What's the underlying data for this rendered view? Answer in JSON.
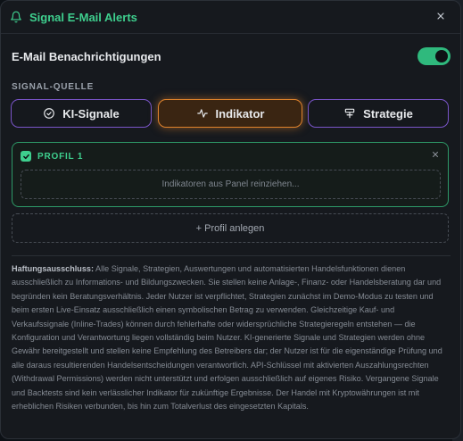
{
  "header": {
    "title": "Signal E-Mail Alerts"
  },
  "email": {
    "label": "E-Mail Benachrichtigungen",
    "enabled": true
  },
  "signal_source": {
    "label": "SIGNAL-QUELLE",
    "options": [
      {
        "label": "KI-Signale",
        "icon": "check-circle-icon",
        "selected": false
      },
      {
        "label": "Indikator",
        "icon": "activity-icon",
        "selected": true
      },
      {
        "label": "Strategie",
        "icon": "strategy-icon",
        "selected": false
      }
    ]
  },
  "profiles": [
    {
      "name": "PROFIL 1",
      "dropzone_text": "Indikatoren aus Panel reinziehen..."
    }
  ],
  "add_profile_label": "+ Profil anlegen",
  "disclaimer": {
    "heading": "Haftungsausschluss:",
    "text": "Alle Signale, Strategien, Auswertungen und automatisierten Handelsfunktionen dienen ausschließlich zu Informations- und Bildungszwecken. Sie stellen keine Anlage-, Finanz- oder Handelsberatung dar und begründen kein Beratungsverhältnis. Jeder Nutzer ist verpflichtet, Strategien zunächst im Demo-Modus zu testen und beim ersten Live-Einsatz ausschließlich einen symbolischen Betrag zu verwenden. Gleichzeitige Kauf- und Verkaufssignale (Inline-Trades) können durch fehlerhafte oder widersprüchliche Strategieregeln entstehen — die Konfiguration und Verantwortung liegen vollständig beim Nutzer. KI-generierte Signale und Strategien werden ohne Gewähr bereitgestellt und stellen keine Empfehlung des Betreibers dar; der Nutzer ist für die eigenständige Prüfung und alle daraus resultierenden Handelsentscheidungen verantwortlich. API-Schlüssel mit aktivierten Auszahlungsrechten (Withdrawal Permissions) werden nicht unterstützt und erfolgen ausschließlich auf eigenes Risiko. Vergangene Signale und Backtests sind kein verlässlicher Indikator für zukünftige Ergebnisse. Der Handel mit Kryptowährungen ist mit erheblichen Risiken verbunden, bis hin zum Totalverlust des eingesetzten Kapitals."
  },
  "colors": {
    "accent_green": "#3ecf8e",
    "accent_orange": "#e0832c",
    "accent_purple": "#7a55c9",
    "background": "#16191e"
  }
}
